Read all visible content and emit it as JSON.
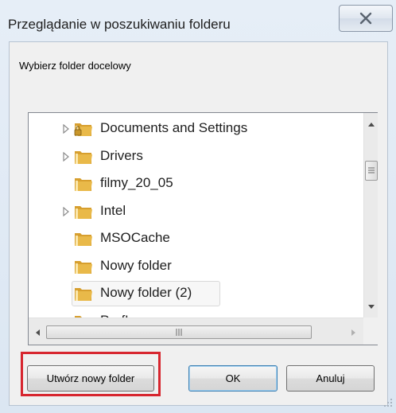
{
  "dialog": {
    "title": "Przeglądanie w poszukiwaniu folderu",
    "close_icon": "close-x-icon",
    "prompt": "Wybierz folder docelowy"
  },
  "tree": {
    "items": [
      {
        "label": "Documents and Settings",
        "expandable": true,
        "icon": "locked-folder-icon"
      },
      {
        "label": "Drivers",
        "expandable": true,
        "icon": "folder-icon"
      },
      {
        "label": "filmy_20_05",
        "expandable": false,
        "icon": "folder-icon"
      },
      {
        "label": "Intel",
        "expandable": true,
        "icon": "folder-icon"
      },
      {
        "label": "MSOCache",
        "expandable": false,
        "icon": "folder-icon"
      },
      {
        "label": "Nowy folder",
        "expandable": false,
        "icon": "folder-icon"
      },
      {
        "label": "Nowy folder (2)",
        "expandable": false,
        "icon": "folder-icon",
        "selected": true
      },
      {
        "label": "PerfLogs",
        "expandable": false,
        "icon": "folder-icon"
      }
    ]
  },
  "buttons": {
    "new_folder": "Utwórz nowy folder",
    "ok": "OK",
    "cancel": "Anuluj"
  },
  "colors": {
    "highlight_box": "#d7262f",
    "folder": "#e9b949"
  }
}
